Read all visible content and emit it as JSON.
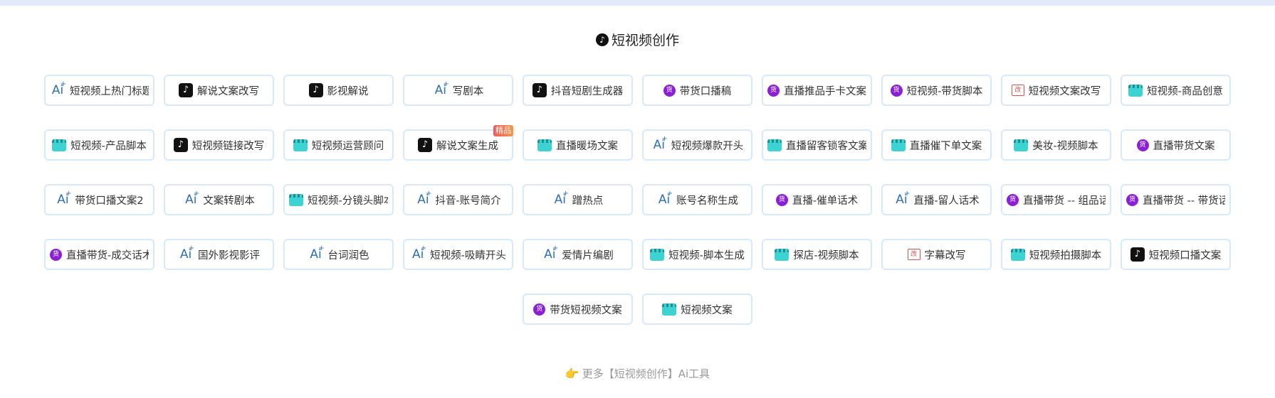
{
  "header": {
    "title": "短视频创作",
    "title_icon": "tiktok-icon"
  },
  "colors": {
    "ai_icon": "#2e6fb7",
    "tiktok_icon": "#111111",
    "goods_icon": "#8a1fd6",
    "edit_icon": "#d9534f",
    "clapper_icon": "#3ed3d3",
    "card_border": "#d6e9fb",
    "top_bar": "#e3e9fb"
  },
  "icon_glyphs": {
    "ai": "Ai",
    "ai_sup": "+",
    "tiktok": "♪",
    "goods": "货",
    "edit": "改"
  },
  "rows": [
    [
      {
        "label": "短视频上热门标题",
        "icon": "ai"
      },
      {
        "label": "解说文案改写",
        "icon": "tiktok"
      },
      {
        "label": "影视解说",
        "icon": "tiktok"
      },
      {
        "label": "写剧本",
        "icon": "ai"
      },
      {
        "label": "抖音短剧生成器",
        "icon": "tiktok"
      },
      {
        "label": "带货口播稿",
        "icon": "goods"
      },
      {
        "label": "直播推品手卡文案",
        "icon": "goods"
      },
      {
        "label": "短视频-带货脚本",
        "icon": "goods"
      },
      {
        "label": "短视频文案改写",
        "icon": "edit"
      },
      {
        "label": "短视频-商品创意",
        "icon": "clapper"
      }
    ],
    [
      {
        "label": "短视频-产品脚本",
        "icon": "clapper"
      },
      {
        "label": "短视频链接改写",
        "icon": "tiktok"
      },
      {
        "label": "短视频运营顾问",
        "icon": "clapper"
      },
      {
        "label": "解说文案生成",
        "icon": "tiktok",
        "badge": "精品"
      },
      {
        "label": "直播暖场文案",
        "icon": "clapper"
      },
      {
        "label": "短视频爆款开头",
        "icon": "ai"
      },
      {
        "label": "直播留客锁客文案",
        "icon": "clapper"
      },
      {
        "label": "直播催下单文案",
        "icon": "clapper"
      },
      {
        "label": "美妆-视频脚本",
        "icon": "clapper"
      },
      {
        "label": "直播带货文案",
        "icon": "goods"
      }
    ],
    [
      {
        "label": "带货口播文案2",
        "icon": "ai"
      },
      {
        "label": "文案转剧本",
        "icon": "ai"
      },
      {
        "label": "短视频-分镜头脚本",
        "icon": "clapper"
      },
      {
        "label": "抖音-账号简介",
        "icon": "ai"
      },
      {
        "label": "蹭热点",
        "icon": "ai"
      },
      {
        "label": "账号名称生成",
        "icon": "ai"
      },
      {
        "label": "直播-催单话术",
        "icon": "goods"
      },
      {
        "label": "直播-留人话术",
        "icon": "ai"
      },
      {
        "label": "直播带货 -- 组品话术",
        "icon": "goods"
      },
      {
        "label": "直播带货 -- 带货话术",
        "icon": "goods"
      }
    ],
    [
      {
        "label": "直播带货-成交话术",
        "icon": "goods"
      },
      {
        "label": "国外影视影评",
        "icon": "ai"
      },
      {
        "label": "台词润色",
        "icon": "ai"
      },
      {
        "label": "短视频-吸睛开头",
        "icon": "ai"
      },
      {
        "label": "爱情片编剧",
        "icon": "ai"
      },
      {
        "label": "短视频-脚本生成",
        "icon": "clapper"
      },
      {
        "label": "探店-视频脚本",
        "icon": "clapper"
      },
      {
        "label": "字幕改写",
        "icon": "edit"
      },
      {
        "label": "短视频拍摄脚本",
        "icon": "clapper"
      },
      {
        "label": "短视频口播文案",
        "icon": "tiktok"
      }
    ],
    [
      {
        "label": "带货短视频文案",
        "icon": "goods"
      },
      {
        "label": "短视频文案",
        "icon": "clapper"
      }
    ]
  ],
  "footer": {
    "more_label": "更多【短视频创作】Ai工具",
    "more_icon": "pointing-hand-icon",
    "hand_glyph": "👉"
  }
}
